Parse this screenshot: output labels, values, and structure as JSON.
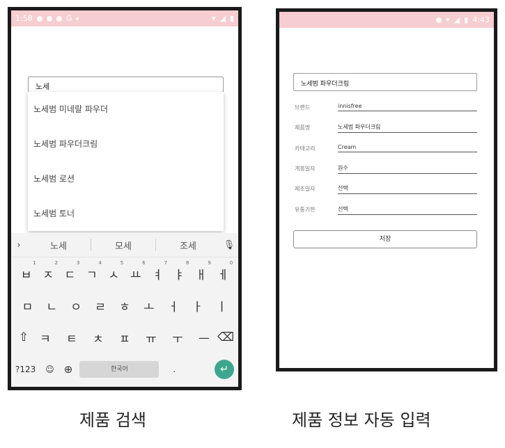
{
  "left_phone": {
    "status_time": "1:58",
    "status_g": "G",
    "search": {
      "value": "노세"
    },
    "dropdown": [
      "노세범 미네랄 파우더",
      "노세범 파우더크림",
      "노세범 로션",
      "노세범 토너"
    ],
    "keyboard": {
      "suggestions": [
        "노세",
        "모세",
        "조세"
      ],
      "row1": [
        {
          "k": "ㅂ",
          "n": "1"
        },
        {
          "k": "ㅈ",
          "n": "2"
        },
        {
          "k": "ㄷ",
          "n": "3"
        },
        {
          "k": "ㄱ",
          "n": "4"
        },
        {
          "k": "ㅅ",
          "n": "5"
        },
        {
          "k": "ㅛ",
          "n": "6"
        },
        {
          "k": "ㅕ",
          "n": "7"
        },
        {
          "k": "ㅑ",
          "n": "8"
        },
        {
          "k": "ㅐ",
          "n": "9"
        },
        {
          "k": "ㅔ",
          "n": "0"
        }
      ],
      "row2": [
        "ㅁ",
        "ㄴ",
        "ㅇ",
        "ㄹ",
        "ㅎ",
        "ㅗ",
        "ㅓ",
        "ㅏ",
        "ㅣ"
      ],
      "row3": [
        "ㅋ",
        "ㅌ",
        "ㅊ",
        "ㅍ",
        "ㅠ",
        "ㅜ",
        "ㅡ"
      ],
      "symbols_key": "?123",
      "space_label": "한국어",
      "period_key": "."
    }
  },
  "right_phone": {
    "status_time": "4:43",
    "product_field": "노세범 파우더크림",
    "fields": [
      {
        "label": "브랜드",
        "value": "innisfree"
      },
      {
        "label": "제품명",
        "value": "노세범 파우더크림"
      },
      {
        "label": "카테고리",
        "value": "Cream"
      },
      {
        "label": "개봉일자",
        "value": "원수"
      },
      {
        "label": "제조일자",
        "value": "선택"
      },
      {
        "label": "유통기한",
        "value": "선택"
      }
    ],
    "save_label": "저장"
  },
  "captions": {
    "left": "제품 검색",
    "right": "제품 정보 자동 입력"
  }
}
